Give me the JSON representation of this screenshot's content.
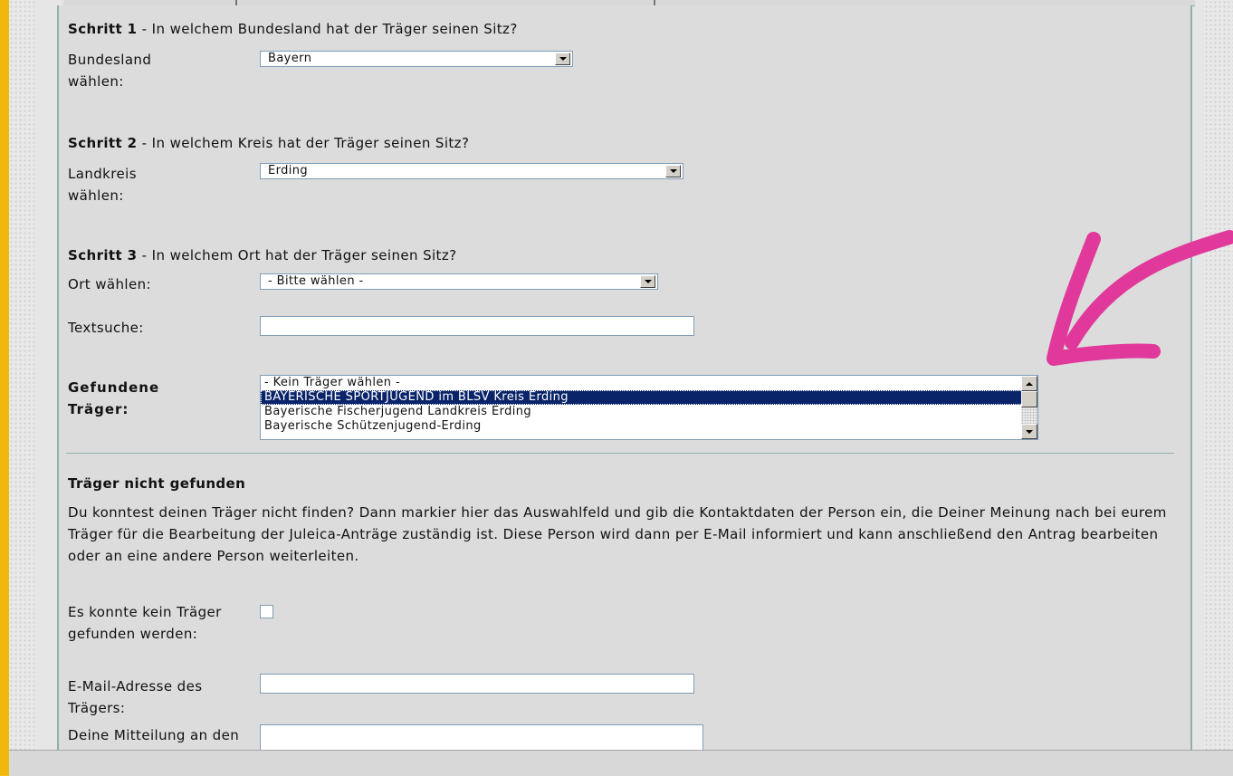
{
  "colors": {
    "frame": "#f3c10f",
    "panel": "#dcdcdc",
    "border": "#8fb0b0",
    "selection": "#0a246a",
    "annotation": "#e0399b"
  },
  "step1": {
    "title": "Schritt 1",
    "question": " - In welchem Bundesland hat der Träger seinen Sitz?",
    "label": "Bundesland wählen:",
    "selected": "Bayern"
  },
  "step2": {
    "title": "Schritt 2",
    "question": " - In welchem Kreis hat der Träger seinen Sitz?",
    "label": "Landkreis wählen:",
    "selected": "Erding"
  },
  "step3": {
    "title": "Schritt 3",
    "question": " - In welchem Ort hat der Träger seinen Sitz?",
    "ort_label": "Ort wählen:",
    "ort_selected": "- Bitte wählen -",
    "textsuche_label": "Textsuche:",
    "textsuche_value": ""
  },
  "found": {
    "label": "Gefundene Träger:",
    "options": [
      "- Kein Träger wählen -",
      "BAYERISCHE SPORTJUGEND im BLSV Kreis Erding",
      "Bayerische Fischerjugend Landkreis Erding",
      "Bayerische Schützenjugend-Erding"
    ],
    "selected_index": 1
  },
  "not_found": {
    "heading": "Träger nicht gefunden",
    "paragraph": "Du konntest deinen Träger nicht finden? Dann markier hier das Auswahlfeld und gib die Kontaktdaten der Person ein, die Deiner Meinung nach bei eurem Träger für die Bearbeitung der Juleica-Anträge zuständig ist. Diese Person wird dann per E-Mail informiert und kann anschließend den Antrag bearbeiten oder an eine andere Person weiterleiten.",
    "checkbox_label": "Es konnte kein Träger gefunden werden:",
    "checkbox_checked": false,
    "email_label": "E-Mail-Adresse des Trägers:",
    "email_value": "",
    "message_label": "Deine Mitteilung an den Träger:",
    "message_value": ""
  }
}
